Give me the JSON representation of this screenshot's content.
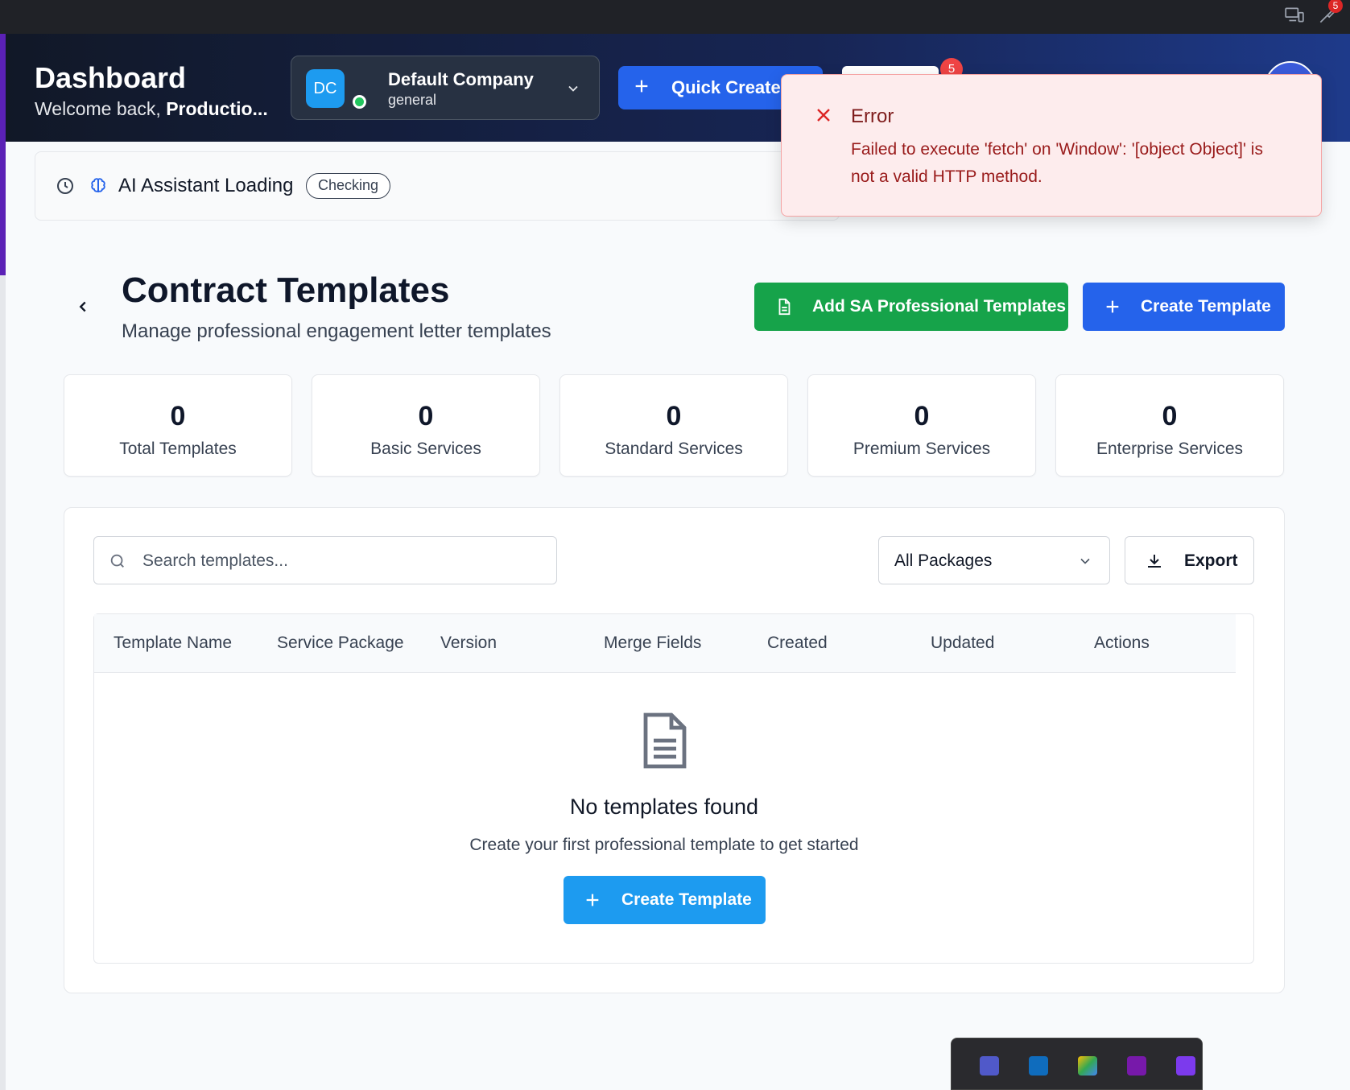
{
  "browser": {
    "notification_count": "5"
  },
  "header": {
    "title": "Dashboard",
    "welcome_prefix": "Welcome back, ",
    "welcome_user": "Productio...",
    "company": {
      "initials": "DC",
      "name": "Default Company",
      "type": "general"
    },
    "quick_create_label": "Quick Create",
    "notification_count": "5"
  },
  "toast": {
    "title": "Error",
    "message": "Failed to execute 'fetch' on 'Window': '[object Object]' is not a valid HTTP method."
  },
  "ai_assistant": {
    "title": "AI Assistant Loading",
    "status": "Checking"
  },
  "page": {
    "title": "Contract Templates",
    "subtitle": "Manage professional engagement letter templates",
    "add_sa_label": "Add SA Professional Templates",
    "create_label": "Create Template"
  },
  "stats": [
    {
      "value": "0",
      "label": "Total Templates"
    },
    {
      "value": "0",
      "label": "Basic Services"
    },
    {
      "value": "0",
      "label": "Standard Services"
    },
    {
      "value": "0",
      "label": "Premium Services"
    },
    {
      "value": "0",
      "label": "Enterprise Services"
    }
  ],
  "toolbar": {
    "search_placeholder": "Search templates...",
    "package_filter": "All Packages",
    "export_label": "Export"
  },
  "table": {
    "columns": [
      "Template Name",
      "Service Package",
      "Version",
      "Merge Fields",
      "Created",
      "Updated",
      "Actions"
    ]
  },
  "empty_state": {
    "title": "No templates found",
    "subtitle": "Create your first professional template to get started",
    "button_label": "Create Template"
  },
  "colors": {
    "primary": "#2563eb",
    "success": "#16a34a",
    "error_bg": "#fdeced",
    "error_text": "#991b1b"
  }
}
